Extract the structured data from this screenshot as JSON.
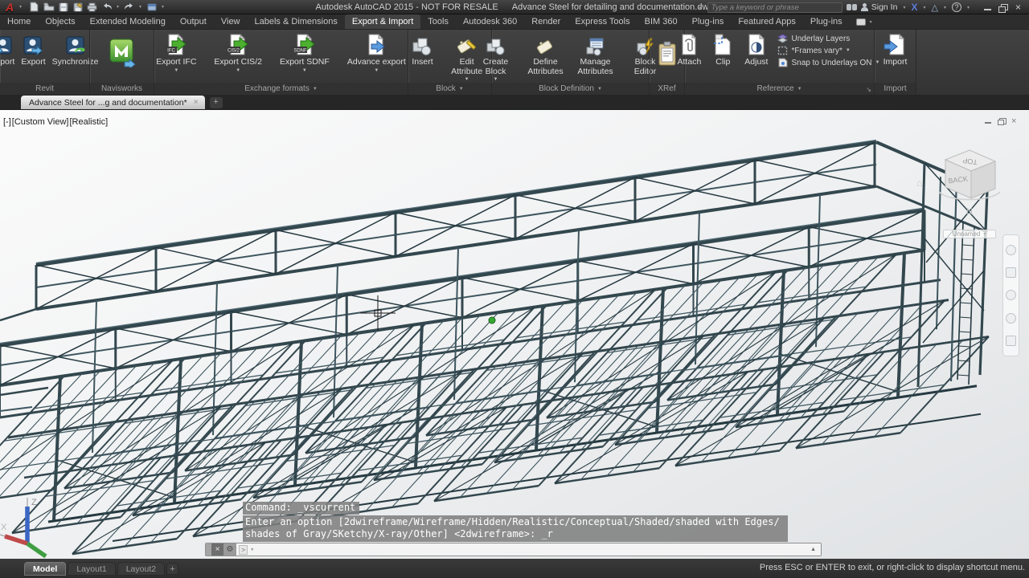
{
  "title_bar": {
    "title_left": "Autodesk AutoCAD 2015 - NOT FOR RESALE",
    "title_right": "Advance Steel  for detailing and documentation.dwg",
    "search_placeholder": "Type a keyword or phrase",
    "sign_in": "Sign In"
  },
  "ribbon_tabs": [
    {
      "label": "Home"
    },
    {
      "label": "Objects"
    },
    {
      "label": "Extended Modeling"
    },
    {
      "label": "Output"
    },
    {
      "label": "View"
    },
    {
      "label": "Labels & Dimensions"
    },
    {
      "label": "Export & Import"
    },
    {
      "label": "Tools"
    },
    {
      "label": "Autodesk 360"
    },
    {
      "label": "Render"
    },
    {
      "label": "Express Tools"
    },
    {
      "label": "BIM 360"
    },
    {
      "label": "Plug-ins"
    },
    {
      "label": "Featured Apps"
    },
    {
      "label": "Plug-ins"
    }
  ],
  "ribbon": {
    "revit": {
      "caption": "Revit",
      "import": "Import",
      "export": "Export",
      "synchronize": "Synchronize"
    },
    "navisworks": {
      "caption": "Navisworks"
    },
    "exchange": {
      "caption": "Exchange formats",
      "export_ifc": "Export IFC",
      "badge_ifc": "IFC",
      "export_cis2": "Export CIS/2",
      "badge_cis2": "CIS/2",
      "export_sdnf": "Export SDNF",
      "badge_sdnf": "SDNF",
      "advance_export": "Advance export"
    },
    "block": {
      "caption": "Block",
      "insert": "Insert",
      "edit_attribute": "Edit Attribute"
    },
    "block_definition": {
      "caption": "Block Definition",
      "create_block": "Create Block",
      "define_attributes": "Define Attributes",
      "manage_attributes": "Manage Attributes",
      "block_editor": "Block Editor"
    },
    "xref": {
      "caption": "XRef"
    },
    "reference": {
      "caption": "Reference",
      "attach": "Attach",
      "clip": "Clip",
      "adjust": "Adjust",
      "underlay_layers": "Underlay Layers",
      "frames_vary": "*Frames vary*",
      "snap_underlays": "Snap to Underlays ON"
    },
    "import_panel": {
      "caption": "Import",
      "import": "Import"
    }
  },
  "file_tabs": {
    "active_tab": "Advance Steel  for ...g and documentation*"
  },
  "viewport": {
    "label_minus": "[-]",
    "label_view": "[Custom View]",
    "label_style": "[Realistic]"
  },
  "viewcube": {
    "top_face": "TOP",
    "front_face": "BACK",
    "north": "N",
    "named_view": "Unnamed"
  },
  "command": {
    "line1": "Command: _vscurrent",
    "line2": "Enter an option [2dwireframe/Wireframe/Hidden/Realistic/Conceptual/Shaded/shaded with Edges/",
    "line3": "shades of Gray/SKetchy/X-ray/Other] <2dwireframe>: _r",
    "prompt": ">"
  },
  "status_bar": {
    "model_tab": "Model",
    "layout1_tab": "Layout1",
    "layout2_tab": "Layout2",
    "hint": "Press ESC or ENTER to exit, or right-click to display shortcut menu."
  },
  "ucs": {
    "z": "Z",
    "x": "X"
  },
  "colors": {
    "steel": "#33474e",
    "steel_dark": "#253940",
    "steel_light": "#57707a",
    "steel_mid": "#3e565f",
    "accent_green": "#36a832",
    "autocad_red": "#c9312b"
  }
}
